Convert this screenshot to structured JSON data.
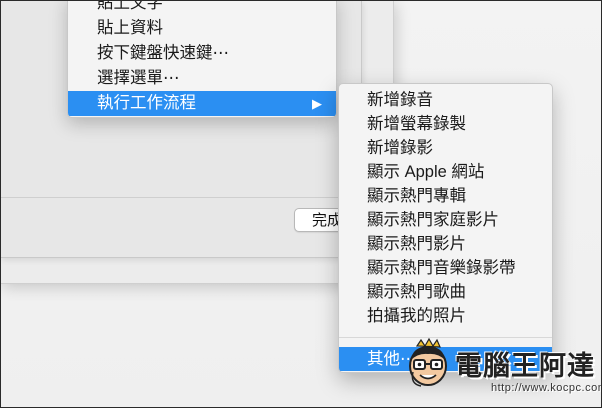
{
  "background_dialog": {
    "done_button_label": "完成"
  },
  "menu": {
    "items": [
      {
        "label": "貼上文字"
      },
      {
        "label": "貼上資料"
      },
      {
        "label": "按下鍵盤快速鍵⋯"
      },
      {
        "label": "選擇選單⋯"
      },
      {
        "label": "執行工作流程",
        "highlighted": true,
        "has_submenu": true
      }
    ],
    "submenu_arrow_icon": "triangle-right-icon"
  },
  "submenu": {
    "items": [
      {
        "label": "新增錄音"
      },
      {
        "label": "新增螢幕錄製"
      },
      {
        "label": "新增錄影"
      },
      {
        "label": "顯示 Apple 網站"
      },
      {
        "label": "顯示熱門專輯"
      },
      {
        "label": "顯示熱門家庭影片"
      },
      {
        "label": "顯示熱門影片"
      },
      {
        "label": "顯示熱門音樂錄影帶"
      },
      {
        "label": "顯示熱門歌曲"
      },
      {
        "label": "拍攝我的照片"
      },
      {
        "label": "其他⋯",
        "highlighted": true
      }
    ]
  },
  "watermark": {
    "title": "電腦王阿達",
    "url": "http://www.kocpc.com.tw"
  },
  "colors": {
    "highlight": "#2b8ff2",
    "menu_background": "#f4f4f4"
  }
}
